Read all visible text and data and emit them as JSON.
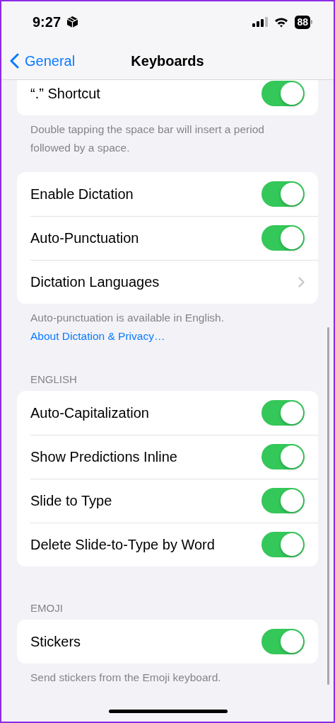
{
  "status_bar": {
    "time": "9:27",
    "battery": "88"
  },
  "nav": {
    "back_label": "General",
    "title": "Keyboards"
  },
  "groups": [
    {
      "rows": [
        {
          "kind": "toggle",
          "label": "“.” Shortcut",
          "on": true
        }
      ],
      "footer": "Double tapping the space bar will insert a period followed by a space."
    },
    {
      "rows": [
        {
          "kind": "toggle",
          "label": "Enable Dictation",
          "on": true
        },
        {
          "kind": "toggle",
          "label": "Auto-Punctuation",
          "on": true
        },
        {
          "kind": "link",
          "label": "Dictation Languages"
        }
      ],
      "footer": "Auto-punctuation is available in English.",
      "footer_link": "About Dictation & Privacy…"
    },
    {
      "header": "ENGLISH",
      "rows": [
        {
          "kind": "toggle",
          "label": "Auto-Capitalization",
          "on": true
        },
        {
          "kind": "toggle",
          "label": "Show Predictions Inline",
          "on": true
        },
        {
          "kind": "toggle",
          "label": "Slide to Type",
          "on": true
        },
        {
          "kind": "toggle",
          "label": "Delete Slide-to-Type by Word",
          "on": true
        }
      ]
    },
    {
      "header": "EMOJI",
      "rows": [
        {
          "kind": "toggle",
          "label": "Stickers",
          "on": true
        }
      ],
      "footer": "Send stickers from the Emoji keyboard."
    }
  ]
}
